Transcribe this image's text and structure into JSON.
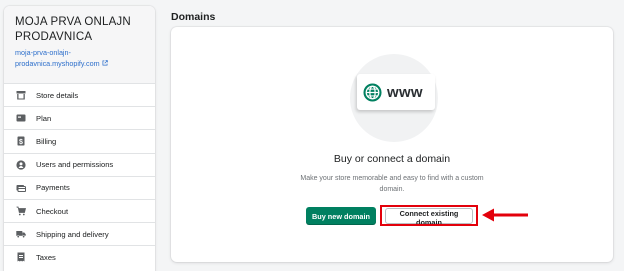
{
  "store": {
    "name": "MOJA PRVA ONLAJN PRODAVNICA",
    "link": "moja-prva-onlajn-prodavnica.myshopify.com"
  },
  "sidebar": {
    "items": [
      {
        "label": "Store details",
        "icon": "store-icon"
      },
      {
        "label": "Plan",
        "icon": "plan-icon"
      },
      {
        "label": "Billing",
        "icon": "billing-icon"
      },
      {
        "label": "Users and permissions",
        "icon": "user-icon"
      },
      {
        "label": "Payments",
        "icon": "payments-icon"
      },
      {
        "label": "Checkout",
        "icon": "cart-icon"
      },
      {
        "label": "Shipping and delivery",
        "icon": "truck-icon"
      },
      {
        "label": "Taxes",
        "icon": "taxes-icon"
      }
    ]
  },
  "main": {
    "title": "Domains",
    "illustration_text": "www",
    "heading": "Buy or connect a domain",
    "subtext": "Make your store memorable and easy to find with a custom domain.",
    "buy_label": "Buy new domain",
    "connect_label": "Connect existing domain"
  },
  "colors": {
    "primary": "#008060",
    "annotation": "#e3000b",
    "link": "#2c6ecb"
  }
}
